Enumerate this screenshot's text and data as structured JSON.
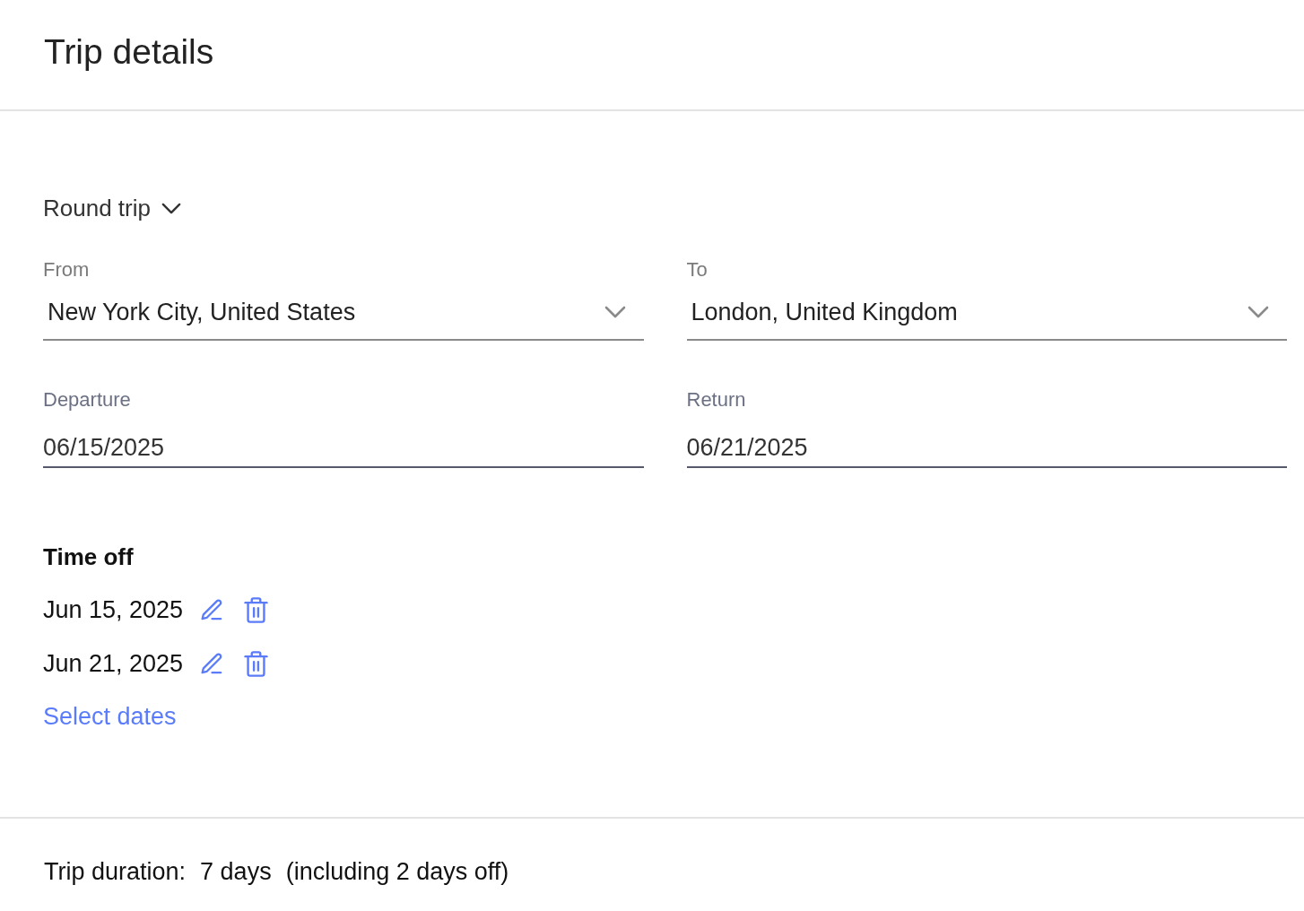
{
  "header": {
    "title": "Trip details"
  },
  "trip_type": {
    "label": "Round trip"
  },
  "fields": [
    {
      "kind": "select",
      "label": "From",
      "value": "New York City, United States"
    },
    {
      "kind": "select",
      "label": "To",
      "value": "London, United Kingdom"
    },
    {
      "kind": "date",
      "label": "Departure",
      "value": "06/15/2025"
    },
    {
      "kind": "date",
      "label": "Return",
      "value": "06/21/2025"
    }
  ],
  "time_off": {
    "title": "Time off",
    "dates": [
      "Jun 15, 2025",
      "Jun 21, 2025"
    ],
    "link": "Select dates"
  },
  "summary": {
    "label": "Trip duration:",
    "duration": "7 days",
    "note": "(including 2 days off)"
  }
}
